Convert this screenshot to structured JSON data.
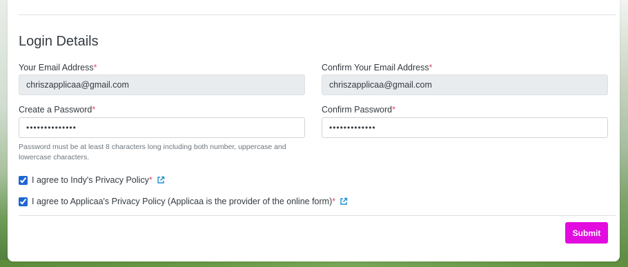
{
  "form": {
    "section_title": "Login Details",
    "email": {
      "label": "Your Email Address",
      "required_mark": "*",
      "value": "chriszapplicaa@gmail.com"
    },
    "confirm_email": {
      "label": "Confirm Your Email Address",
      "required_mark": "*",
      "value": "chriszapplicaa@gmail.com"
    },
    "password": {
      "label": "Create a Password",
      "required_mark": "*",
      "value": "••••••••••••••"
    },
    "confirm_password": {
      "label": "Confirm Password",
      "required_mark": "*",
      "value": "•••••••••••••"
    },
    "password_hint": "Password must be at least 8 characters long including both number, uppercase and lowercase characters.",
    "agreements": [
      {
        "label": "I agree to Indy's Privacy Policy",
        "required_mark": "*",
        "checked": true,
        "icon": "external-link-icon"
      },
      {
        "label": "I agree to Applicaa's Privacy Policy (Applicaa is the provider of the online form)",
        "required_mark": "*",
        "checked": true,
        "icon": "external-link-icon"
      }
    ],
    "submit_label": "Submit"
  },
  "colors": {
    "accent": "#e20ce0",
    "link_icon": "#1a8fd1",
    "required": "#e14b66",
    "readonly_field": "#e9ecef"
  }
}
